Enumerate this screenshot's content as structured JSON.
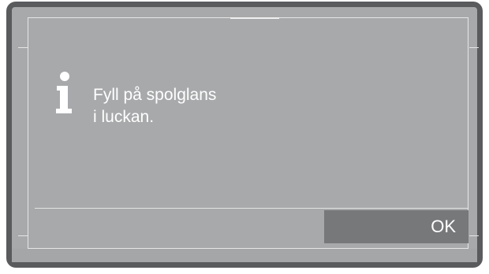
{
  "dialog": {
    "icon": "info-icon",
    "message_line1": "Fyll på spolglans",
    "message_line2": "i luckan.",
    "ok_label": "OK"
  },
  "colors": {
    "frame": "#5a5b5d",
    "screen": "#a8a9ab",
    "button": "#77787a",
    "text": "#ffffff"
  }
}
